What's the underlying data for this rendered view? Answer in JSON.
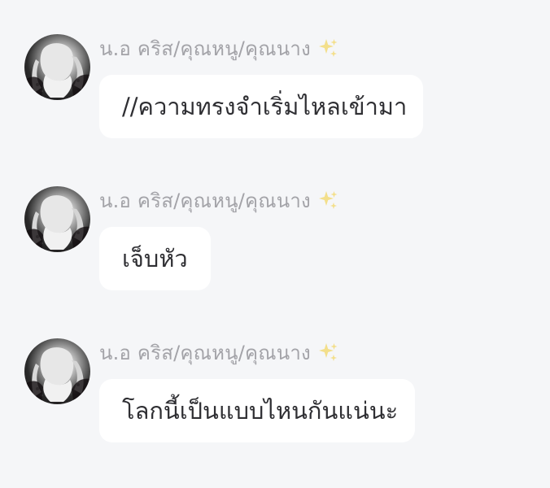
{
  "messages": [
    {
      "sender": "น.อ คริส/คุณหนู/คุณนาง",
      "badge_icon": "sparkle-icon",
      "text": "//ความทรงจำเริ่มไหลเข้ามา"
    },
    {
      "sender": "น.อ คริส/คุณหนู/คุณนาง",
      "badge_icon": "sparkle-icon",
      "text": "เจ็บหัว"
    },
    {
      "sender": "น.อ คริส/คุณหนู/คุณนาง",
      "badge_icon": "sparkle-icon",
      "text": "โลกนี้เป็นแบบไหนกันแน่นะ"
    }
  ],
  "colors": {
    "background": "#f5f6f8",
    "bubble": "#ffffff",
    "sender_name": "#a3a3a8",
    "message_text": "#2f2f33",
    "sparkle": "#f3df8b"
  }
}
